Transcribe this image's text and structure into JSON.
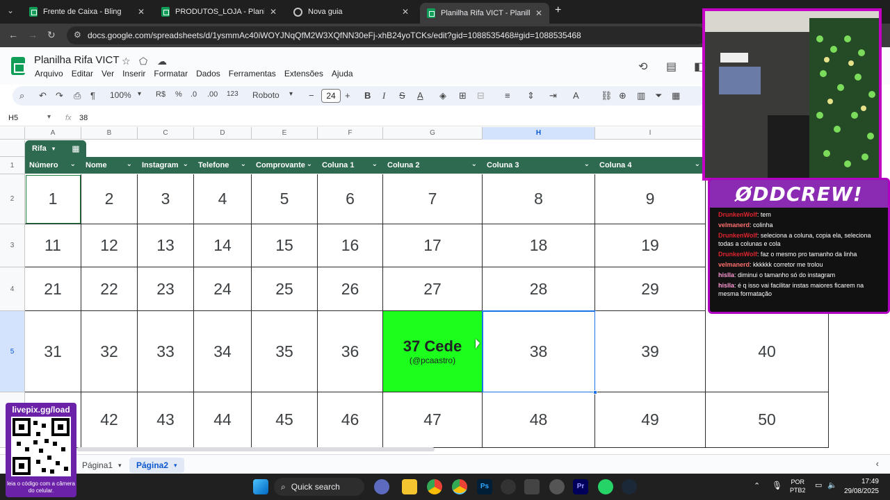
{
  "browser": {
    "tabs": [
      {
        "label": "Frente de Caixa - Bling",
        "active": false
      },
      {
        "label": "PRODUTOS_LOJA - Planilhas Go",
        "active": false
      },
      {
        "label": "Nova guia",
        "active": false
      },
      {
        "label": "Planilha Rifa VICT - Planilhas Go",
        "active": true
      }
    ],
    "new_tab": "+",
    "url": "docs.google.com/spreadsheets/d/1ysmmAc40iWOYJNqQfM2W3XQfNN30eFj-xhB24yoTCKs/edit?gid=1088535468#gid=1088535468"
  },
  "sheets": {
    "title": "Planilha Rifa VICT",
    "menu": [
      "Arquivo",
      "Editar",
      "Ver",
      "Inserir",
      "Formatar",
      "Dados",
      "Ferramentas",
      "Extensões",
      "Ajuda"
    ],
    "toolbar": {
      "zoom": "100%",
      "currency": "R$",
      "percent": "%",
      "dec_decrease": ".0",
      "dec_increase": ".00",
      "number_format": "123",
      "font": "Roboto",
      "font_size": "24"
    },
    "formula_bar": {
      "cell_ref": "H5",
      "fx": "fx",
      "value": "38"
    },
    "columns": [
      "A",
      "B",
      "C",
      "D",
      "E",
      "F",
      "G",
      "H",
      "I"
    ],
    "selected_column": "H",
    "rows": [
      "1",
      "2",
      "3",
      "4",
      "5"
    ],
    "table_name": "Rifa",
    "headers": [
      "Número",
      "Nome",
      "Instagram",
      "Telefone",
      "Comprovante",
      "Coluna 1",
      "Coluna 2",
      "Coluna 3",
      "Coluna 4"
    ],
    "grid": [
      [
        "1",
        "2",
        "3",
        "4",
        "5",
        "6",
        "7",
        "8",
        "9",
        ""
      ],
      [
        "11",
        "12",
        "13",
        "14",
        "15",
        "16",
        "17",
        "18",
        "19",
        ""
      ],
      [
        "21",
        "22",
        "23",
        "24",
        "25",
        "26",
        "27",
        "28",
        "29",
        ""
      ],
      [
        "31",
        "32",
        "33",
        "34",
        "35",
        "36",
        "",
        "38",
        "39",
        "40"
      ],
      [
        "",
        "42",
        "43",
        "44",
        "45",
        "46",
        "47",
        "48",
        "49",
        "50"
      ]
    ],
    "highlight_cell": {
      "main": "37 Cede",
      "sub": "(@pcaastro)",
      "color": "#1cff1c"
    },
    "sheet_tabs": [
      {
        "label": "Página1",
        "active": false
      },
      {
        "label": "Página2",
        "active": true
      }
    ]
  },
  "overlay": {
    "chat_logo": "ØDDCREW!",
    "chat": [
      {
        "user": "DrunkenWolf",
        "text": ": tem"
      },
      {
        "user": "velmanerd",
        "text": ": colinha"
      },
      {
        "user": "DrunkenWolf",
        "text": ": seleciona a coluna, copia ela, seleciona todas a colunas e cola"
      },
      {
        "user": "DrunkenWolf",
        "text": ": faz o mesmo pro tamanho da linha"
      },
      {
        "user": "velmanerd",
        "text": ": kkkkkk corretor me trolou"
      },
      {
        "user": "hislla",
        "text": ": diminui o tamanho só do instagram"
      },
      {
        "user": "hislla",
        "text": ": é q isso vai facilitar instas maiores ficarem na mesma formatação"
      }
    ],
    "qr_title": "livepix.gg/load",
    "qr_caption": "leia o código com a câmera do celular."
  },
  "taskbar": {
    "search": "Quick search",
    "lang": "POR",
    "layout": "PTB2",
    "time": "17:49",
    "date": "29/08/2025"
  }
}
